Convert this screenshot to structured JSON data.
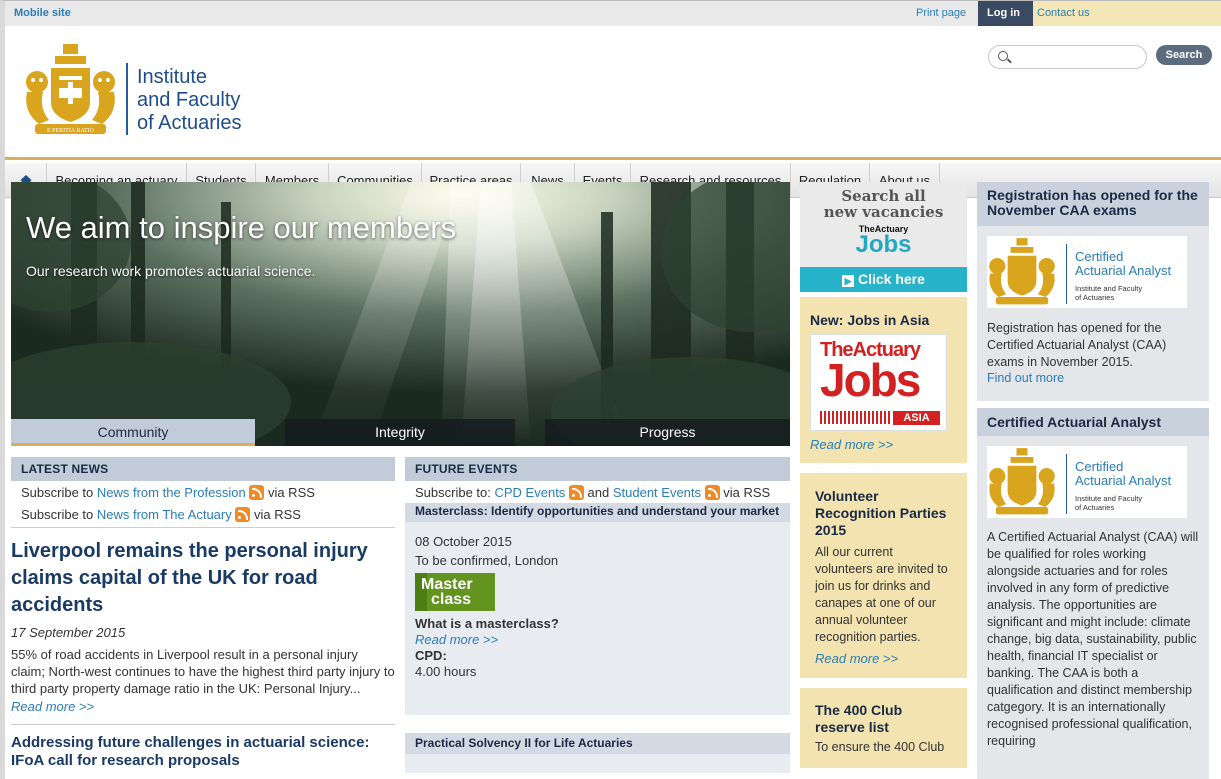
{
  "topbar": {
    "mobile": "Mobile site",
    "print": "Print page",
    "login": "Log in",
    "contact": "Contact us"
  },
  "logo": {
    "line1": "Institute",
    "line2": "and Faculty",
    "line3": "of Actuaries",
    "motto": "E PERITIA RATIO"
  },
  "search": {
    "placeholder": "",
    "button": "Search"
  },
  "nav": [
    "Becoming an actuary",
    "Students",
    "Members",
    "Communities",
    "Practice areas",
    "News",
    "Events",
    "Research and resources",
    "Regulation",
    "About us"
  ],
  "hero": {
    "title": "We aim to inspire our members",
    "subtitle": "Our research work promotes actuarial science.",
    "tabs": [
      "Community",
      "Integrity",
      "Progress"
    ],
    "active_tab": "Community"
  },
  "news": {
    "heading": "LATEST NEWS",
    "sub1": {
      "pre": "Subscribe to ",
      "link": "News from the Profession",
      "post": " via RSS"
    },
    "sub2": {
      "pre": "Subscribe to ",
      "link": "News from The Actuary",
      "post": " via RSS"
    },
    "article1": {
      "title": "Liverpool remains the personal injury claims capital of the UK for road accidents",
      "date": "17 September 2015",
      "body": "55% of road accidents in Liverpool result in a personal injury claim; North-west continues to have the highest third party injury to third party property damage ratio in the UK: Personal Injury...",
      "more": "Read more >>"
    },
    "article2": {
      "title": "Addressing future challenges in actuarial science: IFoA call for research proposals"
    }
  },
  "events": {
    "heading": "FUTURE EVENTS",
    "sub": {
      "pre": "Subscribe to: ",
      "link1": "CPD Events",
      "mid": " and ",
      "link2": "Student Events",
      "post": " via RSS"
    },
    "event1": {
      "title": "Masterclass: Identify opportunities and understand your market",
      "date": "08 October 2015",
      "location": "To be confirmed, London",
      "badge_line1": "Master",
      "badge_line2": "class",
      "question": "What is a masterclass?",
      "more": "Read more >>",
      "cpd_label": "CPD:",
      "cpd_value": "4.00 hours"
    },
    "event2": {
      "title": "Practical Solvency II for Life Actuaries"
    }
  },
  "mid": {
    "jobs_ad": {
      "line1": "Search all",
      "line2": "new vacancies",
      "brand_small": "TheActuary",
      "brand_big": "Jobs",
      "cta": "Click here"
    },
    "asia": {
      "title": "New: Jobs in Asia",
      "brand_top": "TheActuary",
      "brand_big": "Jobs",
      "brand_region": "ASIA",
      "more": "Read more >>"
    },
    "volunteer": {
      "title": "Volunteer Recognition Parties 2015",
      "body": "All our current volunteers are invited to join us for drinks and canapes at one of our annual volunteer recognition parties.",
      "more": "Read more >>"
    },
    "club": {
      "title": "The 400 Club reserve list",
      "body": "To ensure the 400 Club"
    }
  },
  "right": {
    "reg": {
      "title": "Registration has opened for the November CAA exams",
      "logo_l1": "Certified",
      "logo_l2": "Actuarial Analyst",
      "logo_l3": "Institute and Faculty",
      "logo_l4": "of Actuaries",
      "body": "Registration has opened for the Certified Actuarial Analyst (CAA) exams in November 2015.",
      "more": "Find out more"
    },
    "caa": {
      "title": "Certified Actuarial Analyst",
      "logo_l1": "Certified",
      "logo_l2": "Actuarial Analyst",
      "logo_l3": "Institute and Faculty",
      "logo_l4": "of Actuaries",
      "body": "A Certified Actuarial Analyst (CAA) will be qualified for roles working alongside actuaries and for roles involved in any form of predictive analysis.  The opportunities are significant and might include: climate change, big data, sustainability, public health, financial IT specialist or banking.  The CAA is both a qualification and distinct membership catgegory.  It is an internationally recognised professional qualification, requiring"
    }
  },
  "colors": {
    "gold": "#d6b05a",
    "navy": "#1a2a45",
    "link": "#2a7db8",
    "beige": "#f2e3b0"
  }
}
